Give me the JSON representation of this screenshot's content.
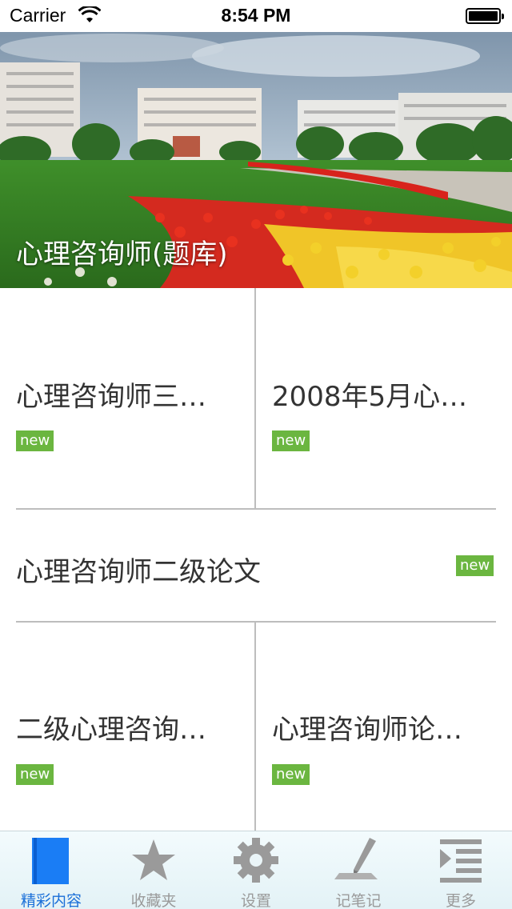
{
  "status_bar": {
    "carrier": "Carrier",
    "time": "8:54 PM"
  },
  "hero": {
    "title": "心理咨询师(题库)"
  },
  "items": [
    {
      "title": "心理咨询师三…",
      "badge": "new"
    },
    {
      "title": "2008年5月心…",
      "badge": "new"
    },
    {
      "title": "心理咨询师二级论文",
      "badge": "new"
    },
    {
      "title": "二级心理咨询…",
      "badge": "new"
    },
    {
      "title": "心理咨询师论…",
      "badge": "new"
    }
  ],
  "tabs": [
    {
      "label": "精彩内容",
      "icon": "book-icon",
      "active": true
    },
    {
      "label": "收藏夹",
      "icon": "star-icon",
      "active": false
    },
    {
      "label": "设置",
      "icon": "gear-icon",
      "active": false
    },
    {
      "label": "记笔记",
      "icon": "pen-icon",
      "active": false
    },
    {
      "label": "更多",
      "icon": "list-icon",
      "active": false
    }
  ],
  "colors": {
    "badge": "#6bb640",
    "active_tab": "#1a6fd8",
    "inactive_tab": "#9a9a9a"
  }
}
